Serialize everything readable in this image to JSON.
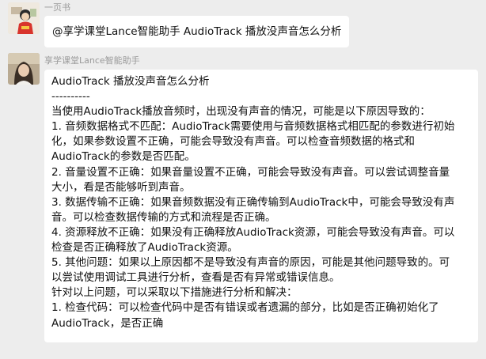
{
  "messages": [
    {
      "sender": "一页书",
      "text": "@享学课堂Lance智能助手 AudioTrack 播放没声音怎么分析"
    },
    {
      "sender": "享学课堂Lance智能助手",
      "lines": [
        "AudioTrack 播放没声音怎么分析",
        "----------",
        "当使用AudioTrack播放音频时，出现没有声音的情况，可能是以下原因导致的：",
        "1. 音频数据格式不匹配：AudioTrack需要使用与音频数据格式相匹配的参数进行初始",
        "化，如果参数设置不正确，可能会导致没有声音。可以检查音频数据的格式和",
        "AudioTrack的参数是否匹配。",
        "2. 音量设置不正确：如果音量设置不正确，可能会导致没有声音。可以尝试调整音量",
        "大小，看是否能够听到声音。",
        "3. 数据传输不正确：如果音频数据没有正确传输到AudioTrack中，可能会导致没有声",
        "音。可以检查数据传输的方式和流程是否正确。",
        "4. 资源释放不正确：如果没有正确释放AudioTrack资源，可能会导致没有声音。可以",
        "检查是否正确释放了AudioTrack资源。",
        "5. 其他问题：如果以上原因都不是导致没有声音的原因，可能是其他问题导致的。可",
        "以尝试使用调试工具进行分析，查看是否有异常或错误信息。",
        "针对以上问题，可以采取以下措施进行分析和解决：",
        "1. 检查代码：可以检查代码中是否有错误或者遗漏的部分，比如是否正确初始化了",
        "AudioTrack，是否正确"
      ]
    }
  ],
  "colors": {
    "background": "#ededed",
    "bubble": "#ffffff",
    "sender_name": "#9a9a9a"
  },
  "icons": [
    "user-avatar",
    "assistant-avatar"
  ]
}
